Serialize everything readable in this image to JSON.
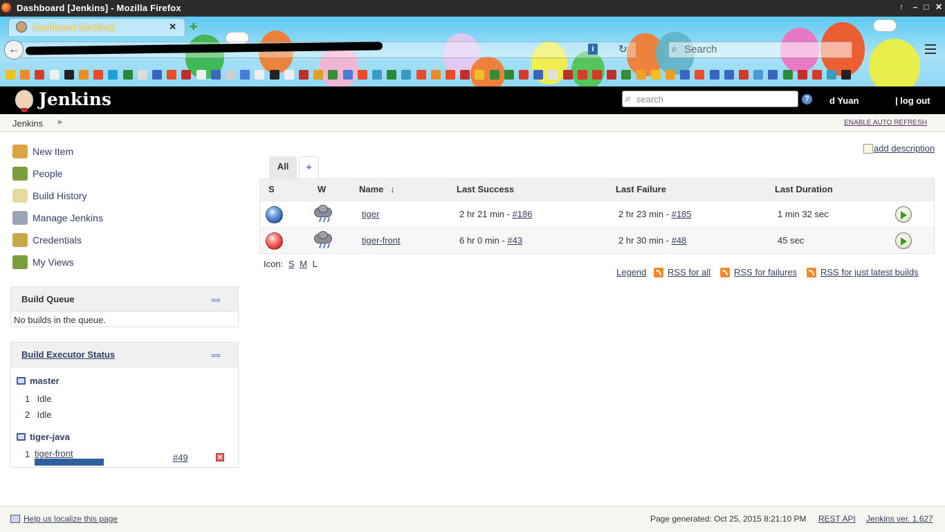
{
  "window": {
    "title": "Dashboard [Jenkins] - Mozilla Firefox",
    "controls": [
      "↑",
      "–",
      "□",
      "✕"
    ]
  },
  "browser": {
    "tab_title": "Dashboard [Jenkins]",
    "tab_close": "✕",
    "new_tab": "+",
    "search_placeholder": "Search",
    "identity_icon": "i",
    "reload_icon": "↻",
    "back_icon": "←",
    "theme_colors": {
      "sky": "#5ec8f2",
      "tab_text": "#fff8a0"
    }
  },
  "jenkins": {
    "brand": "Jenkins",
    "search_placeholder": "search",
    "help": "?",
    "user": "d Yuan",
    "logout": "| log out",
    "colors": {
      "header_bg": "#000000",
      "link": "#333f63",
      "success_ball": "#2f62b3",
      "failure_ball": "#e03131",
      "progress": "#305f9e"
    }
  },
  "breadcrumb": {
    "items": [
      "Jenkins"
    ],
    "separator": "▶",
    "auto_refresh": "ENABLE AUTO REFRESH"
  },
  "sidebar": {
    "tasks": [
      {
        "label": "New Item",
        "icon": "new-item-icon",
        "color": "#d9a441"
      },
      {
        "label": "People",
        "icon": "people-icon",
        "color": "#7a9e3c"
      },
      {
        "label": "Build History",
        "icon": "notepad-icon",
        "color": "#e8d9a0"
      },
      {
        "label": "Manage Jenkins",
        "icon": "tools-icon",
        "color": "#9aa6b8"
      },
      {
        "label": "Credentials",
        "icon": "keys-icon",
        "color": "#c9a84a"
      },
      {
        "label": "My Views",
        "icon": "user-views-icon",
        "color": "#7a9e3c"
      }
    ],
    "build_queue": {
      "title": "Build Queue",
      "empty": "No builds in the queue."
    },
    "executors": {
      "title": "Build Executor Status",
      "nodes": [
        {
          "name": "master",
          "executors": [
            {
              "num": "1",
              "status": "Idle"
            },
            {
              "num": "2",
              "status": "Idle"
            }
          ]
        },
        {
          "name": "tiger-java",
          "executors": [
            {
              "num": "1",
              "job": "tiger-front",
              "build": "#49",
              "progress": 1.0,
              "stop": "✕"
            }
          ]
        }
      ]
    }
  },
  "main": {
    "add_description": "add description",
    "view_tabs": [
      {
        "label": "All",
        "active": true
      },
      {
        "label": "+",
        "active": false
      }
    ],
    "table": {
      "headers": {
        "status": "S",
        "weather": "W",
        "name": "Name",
        "sort_arrow": "↓",
        "last_success": "Last Success",
        "last_failure": "Last Failure",
        "last_duration": "Last Duration"
      },
      "rows": [
        {
          "status": "blue",
          "weather": "thunderstorm-icon",
          "name": "tiger",
          "last_success_time": "2 hr 21 min - ",
          "last_success_build": "#186",
          "last_failure_time": "2 hr 23 min - ",
          "last_failure_build": "#185",
          "duration": "1 min 32 sec"
        },
        {
          "status": "red",
          "weather": "thunderstorm-icon",
          "name": "tiger-front",
          "last_success_time": "6 hr 0 min - ",
          "last_success_build": "#43",
          "last_failure_time": "2 hr 30 min - ",
          "last_failure_build": "#48",
          "duration": "45 sec"
        }
      ]
    },
    "icon_size": {
      "label": "Icon:",
      "sizes": [
        "S",
        "M",
        "L"
      ]
    },
    "rss": {
      "legend": "Legend",
      "all": "RSS for all",
      "failures": "RSS for failures",
      "latest": "RSS for just latest builds"
    }
  },
  "footer": {
    "localize": "Help us localize this page",
    "generated": "Page generated: Oct 25, 2015 8:21:10 PM",
    "rest_api": "REST API",
    "version": "Jenkins ver. 1.627"
  }
}
